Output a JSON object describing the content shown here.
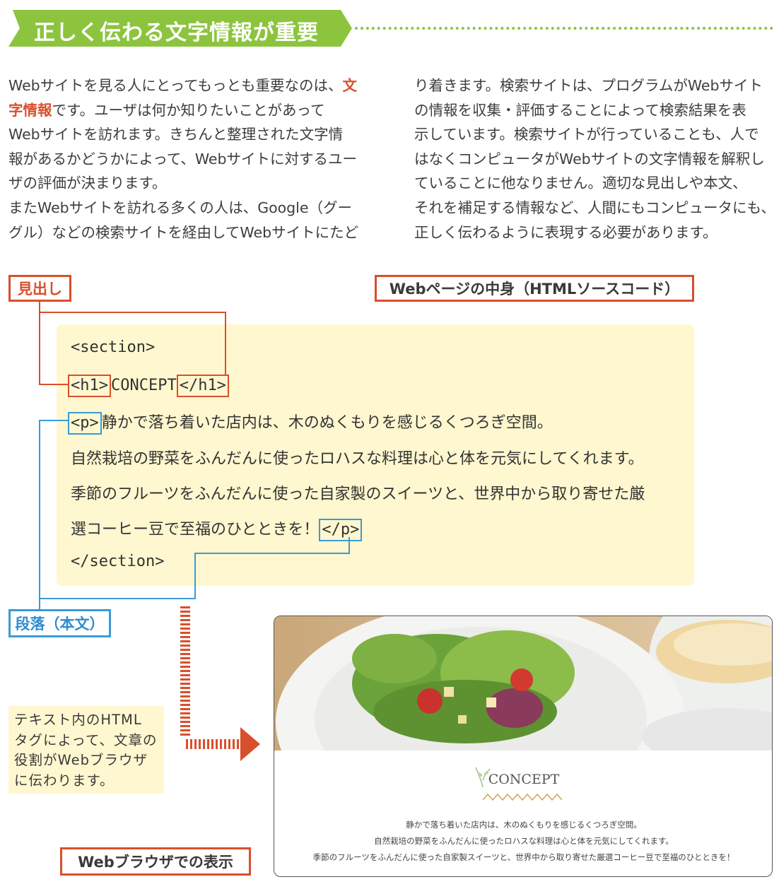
{
  "banner": {
    "title": "正しく伝わる文字情報が重要"
  },
  "intro": {
    "left": [
      {
        "pre": "Webサイトを見る人にとってもっとも重要なのは、",
        "hl": "文",
        "post": ""
      },
      {
        "pre": "",
        "hl": "字情報",
        "post": "です。ユーザは何か知りたいことがあって"
      },
      {
        "pre": "Webサイトを訪れます。きちんと整理された文字情",
        "hl": "",
        "post": ""
      },
      {
        "pre": "報があるかどうかによって、Webサイトに対するユー",
        "hl": "",
        "post": ""
      },
      {
        "pre": "ザの評価が決まります。",
        "hl": "",
        "post": ""
      },
      {
        "pre": "またWebサイトを訪れる多くの人は、Google（グー",
        "hl": "",
        "post": ""
      },
      {
        "pre": "グル）などの検索サイトを経由してWebサイトにたど",
        "hl": "",
        "post": ""
      }
    ],
    "right": [
      "り着きます。検索サイトは、プログラムがWebサイト",
      "の情報を収集・評価することによって検索結果を表",
      "示しています。検索サイトが行っていることも、人で",
      "はなくコンピュータがWebサイトの文字情報を解釈し",
      "ていることに他なりません。適切な見出しや本文、",
      "それを補足する情報など、人間にもコンピュータにも、",
      "正しく伝わるように表現する必要があります。"
    ]
  },
  "labels": {
    "heading": "見出し",
    "source": "Webページの中身（HTMLソースコード）",
    "paragraph": "段落（本文）",
    "browser": "Webブラウザでの表示"
  },
  "code": {
    "section_open": "<section>",
    "h1_open": "<h1>",
    "h1_text": "CONCEPT",
    "h1_close": "</h1>",
    "p_open": "<p>",
    "p_line1": "静かで落ち着いた店内は、木のぬくもりを感じるくつろぎ空間。",
    "p_line2": "自然栽培の野菜をふんだんに使ったロハスな料理は心と体を元気にしてくれます。",
    "p_line3": "季節のフルーツをふんだんに使った自家製のスイーツと、世界中から取り寄せた厳",
    "p_line4": "選コーヒー豆で至福のひとときを！",
    "p_close": "</p>",
    "section_close": "</section>"
  },
  "note": {
    "lines": [
      "テキスト内のHTML",
      "タグによって、文章の",
      "役割がWebブラウザ",
      "に伝わります。"
    ]
  },
  "preview": {
    "title": "CONCEPT",
    "lines": [
      "静かで落ち着いた店内は、木のぬくもりを感じるくつろぎ空間。",
      "自然栽培の野菜をふんだんに使ったロハスな料理は心と体を元気にしてくれます。",
      "季節のフルーツをふんだんに使った自家製スイーツと、世界中から取り寄せた厳選コーヒー豆で至福のひとときを！"
    ]
  },
  "colors": {
    "banner_green": "#8cc43e",
    "accent_red": "#d94f2b",
    "accent_blue": "#3a9bd8",
    "code_bg": "#fff7cf"
  }
}
